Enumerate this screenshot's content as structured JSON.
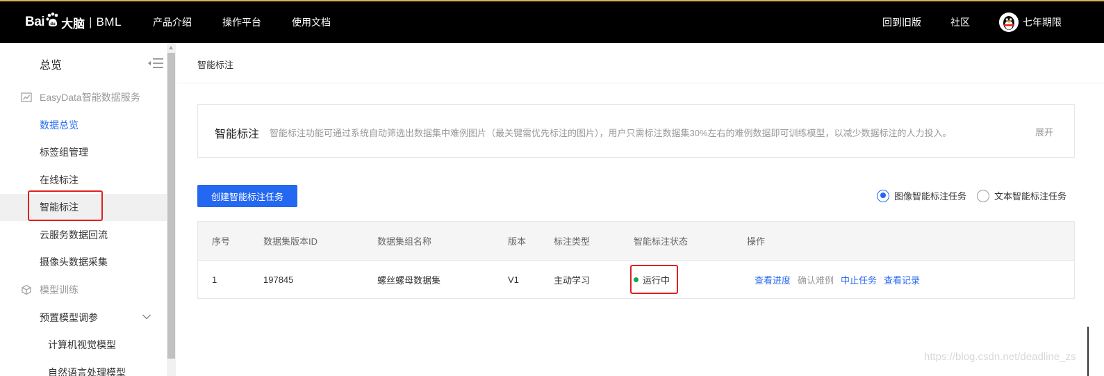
{
  "header": {
    "logo": {
      "bai": "Bai",
      "paw_text": "du",
      "brain": "大脑",
      "separator": "|",
      "bml": "BML"
    },
    "nav_left": [
      "产品介绍",
      "操作平台",
      "使用文档"
    ],
    "nav_right": {
      "old_version": "回到旧版",
      "community": "社区",
      "username": "七年期限"
    }
  },
  "sidebar": {
    "title": "总览",
    "groups": [
      {
        "label": "EasyData智能数据服务",
        "icon": "chart-icon"
      },
      {
        "label": "模型训练",
        "icon": "cube-icon"
      }
    ],
    "items": [
      {
        "label": "数据总览",
        "active": true
      },
      {
        "label": "标签组管理"
      },
      {
        "label": "在线标注"
      },
      {
        "label": "智能标注",
        "hover": true
      },
      {
        "label": "云服务数据回流"
      },
      {
        "label": "摄像头数据采集"
      }
    ],
    "training_items": [
      {
        "label": "预置模型调参"
      },
      {
        "label": "计算机视觉模型"
      },
      {
        "label": "自然语言处理模型"
      }
    ]
  },
  "breadcrumb": "智能标注",
  "info": {
    "title": "智能标注",
    "description": "智能标注功能可通过系统自动筛选出数据集中难例图片（最关键需优先标注的图片），用户只需标注数据集30%左右的难例数据即可训练模型，以减少数据标注的人力投入。",
    "expand": "展开"
  },
  "create_button": "创建智能标注任务",
  "radios": [
    {
      "label": "图像智能标注任务",
      "checked": true
    },
    {
      "label": "文本智能标注任务",
      "checked": false
    }
  ],
  "table": {
    "headers": [
      "序号",
      "数据集版本ID",
      "数据集组名称",
      "版本",
      "标注类型",
      "智能标注状态",
      "操作"
    ],
    "rows": [
      {
        "index": "1",
        "version_id": "197845",
        "group_name": "螺丝螺母数据集",
        "version": "V1",
        "annotation_type": "主动学习",
        "status": "运行中",
        "actions": [
          "查看进度",
          "确认难例",
          "中止任务",
          "查看记录"
        ]
      }
    ]
  },
  "watermark": "https://blog.csdn.net/deadline_zs",
  "colors": {
    "accent": "#2468f2",
    "status_running": "#11a84b",
    "highlight": "#e02020",
    "topbar": "#000000"
  }
}
